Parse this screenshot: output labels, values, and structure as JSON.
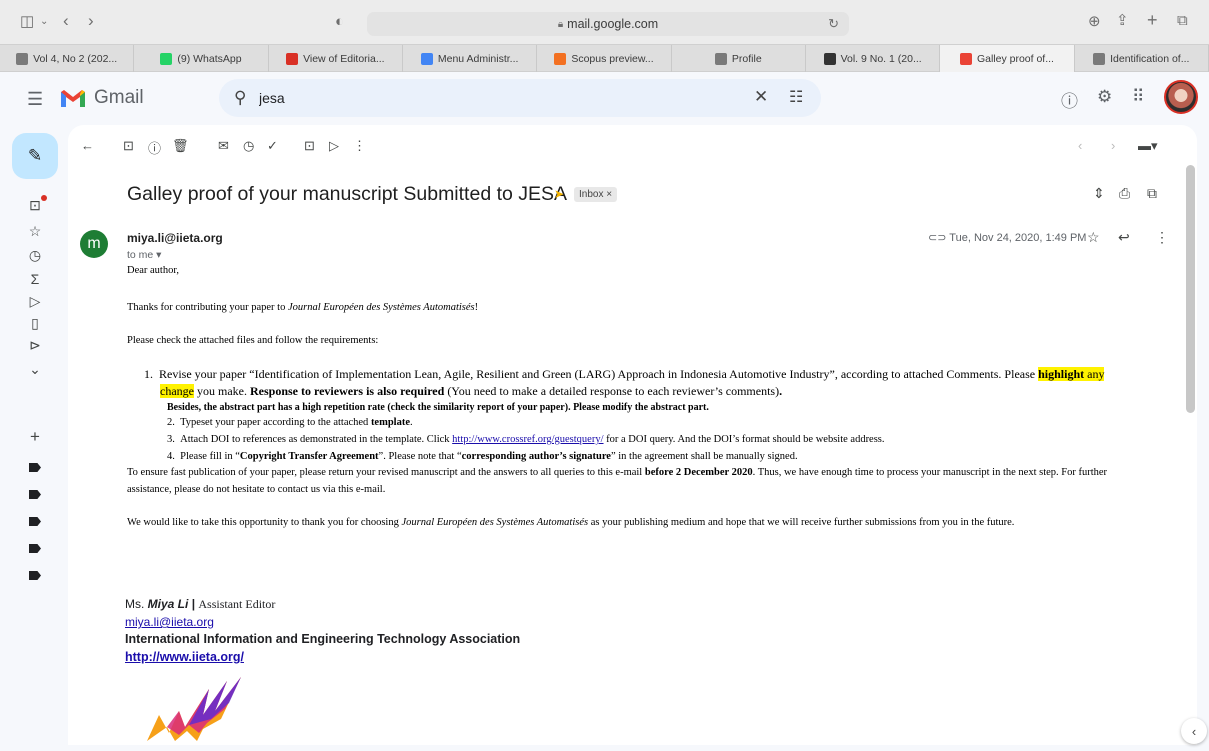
{
  "browser": {
    "url": "mail.google.com",
    "tabs": [
      {
        "label": "Vol 4, No 2 (202...",
        "icon": "journal-icon",
        "color": "#7a7a7a"
      },
      {
        "label": "(9) WhatsApp",
        "icon": "whatsapp-icon",
        "color": "#25d366"
      },
      {
        "label": "View of Editoria...",
        "icon": "star-burst-icon",
        "color": "#d93025"
      },
      {
        "label": "Menu Administr...",
        "icon": "menu-admin-icon",
        "color": "#4285f4"
      },
      {
        "label": "Scopus preview...",
        "icon": "scopus-icon",
        "color": "#f37021"
      },
      {
        "label": "Profile",
        "icon": "profile-icon",
        "color": "#7a7a7a"
      },
      {
        "label": "Vol. 9 No. 1 (20...",
        "icon": "pkp-icon",
        "color": "#333333"
      },
      {
        "label": "Galley proof of...",
        "icon": "gmail-icon",
        "color": "#ea4335",
        "active": true
      },
      {
        "label": "Identification of...",
        "icon": "document-icon",
        "color": "#7a7a7a"
      }
    ]
  },
  "gmail": {
    "brand": "Gmail",
    "search_value": "jesa",
    "accent": "#0b57d0"
  },
  "email": {
    "subject": "Galley proof of your manuscript Submitted to JESA",
    "label_chip": "Inbox ×",
    "sender": "miya.li@iieta.org",
    "avatar_letter": "m",
    "to": "to me ▾",
    "date": "Tue, Nov 24, 2020, 1:49 PM",
    "greeting": "Dear author,",
    "thanks_a": "Thanks for contributing your paper to ",
    "journal": "Journal Européen des Systèmes Automatisés",
    "thanks_b": "!",
    "check": "Please check the attached files and follow the requirements:",
    "item1_a": "Revise your paper “Identification of Implementation Lean, Agile, Resilient and Green (LARG) Approach in Indonesia Automotive Industry”, according to attached Comments. Please ",
    "item1_hl1": "highlight",
    "item1_hl2": " any",
    "item1_hl3": "change",
    "item1_b": " you make. ",
    "item1_bold": "Response to reviewers is also required",
    "item1_c": " (You need to make a detailed response to each reviewer’s comments)",
    "item1_dot": ".",
    "item1_extra": "Besides, the abstract part has a high repetition rate (check the similarity report of your paper). Please modify the abstract part.",
    "item2_a": "Typeset your paper according to the attached ",
    "item2_bold": "template",
    "item2_b": ".",
    "item3_a": "Attach DOI to references as demonstrated in the template. Click ",
    "item3_link": "http://www.crossref.org/guestquery/",
    "item3_b": " for a DOI query. And the DOI’s format should be website address.",
    "item4_a": "Please fill in “",
    "item4_bold1": "Copyright Transfer Agreement",
    "item4_b": "”. Please note that “",
    "item4_bold2": "corresponding author’s signature",
    "item4_c": "” in the agreement shall be manually signed.",
    "ensure_a": "To ensure fast publication of your paper, please return your revised manuscript and the answers to all queries to this e-mail ",
    "ensure_bold": "before 2 December 2020",
    "ensure_b": ". Thus, we have enough time to process your manuscript in the next step. For further",
    "ensure_c": "assistance, please do not hesitate to contact us via this e-mail.",
    "closing_a": "We would like to take this opportunity to thank you for choosing ",
    "closing_b": " as your publishing medium and hope that we will receive further submissions from you in the future.",
    "sig_ms": "Ms. ",
    "sig_name": "Miya Li",
    "sig_sep": " | ",
    "sig_role": "Assistant Editor",
    "sig_email": "miya.li@iieta.org",
    "sig_org": "International Information and Engineering Technology Association",
    "sig_web": "http://www.iieta.org/"
  }
}
